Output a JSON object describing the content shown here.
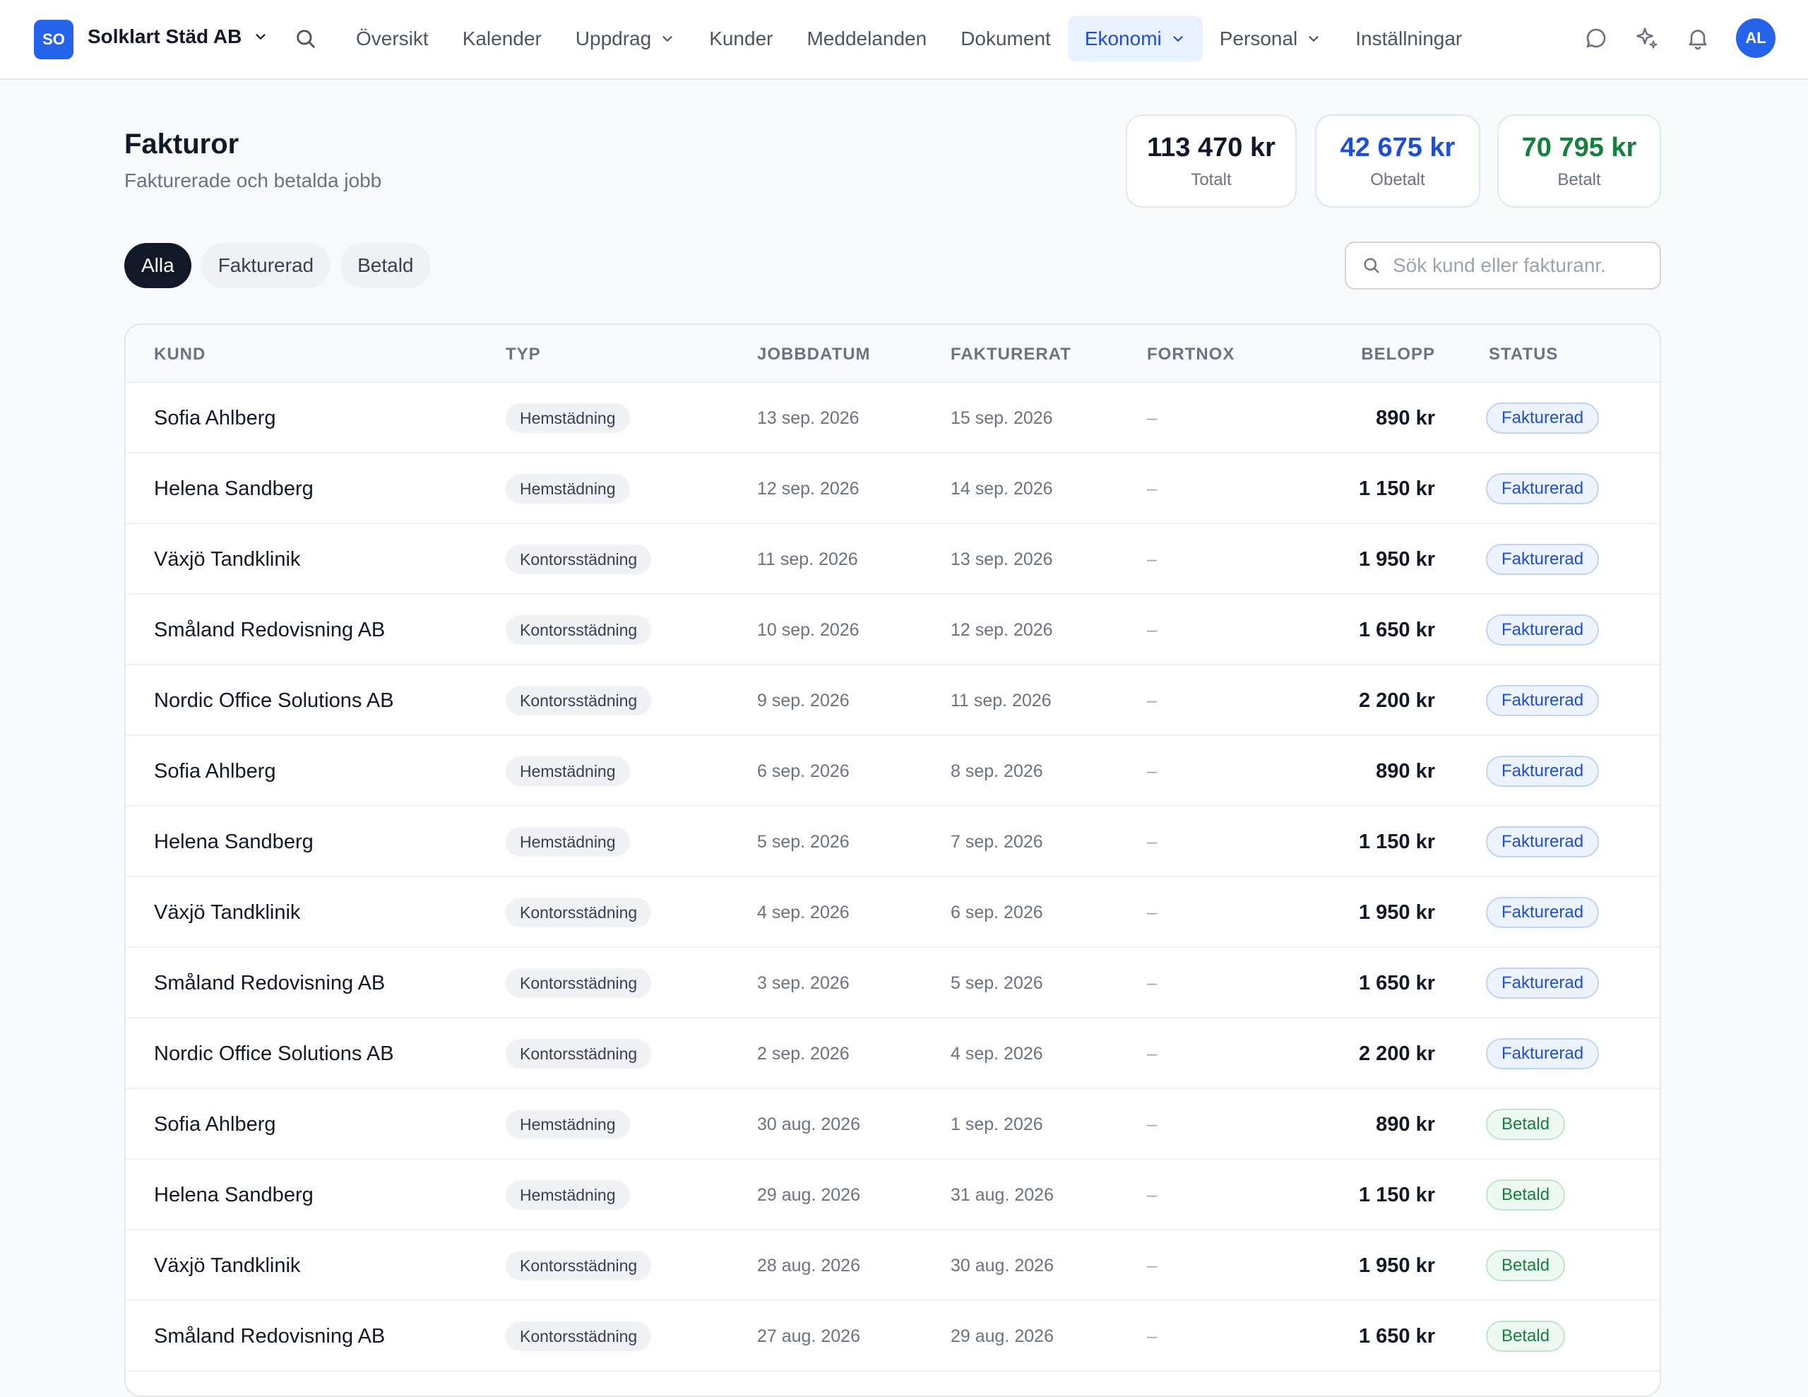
{
  "nav": {
    "logo": "SO",
    "company": "Solklart Städ AB",
    "items": [
      {
        "label": "Översikt",
        "dropdown": false,
        "active": false
      },
      {
        "label": "Kalender",
        "dropdown": false,
        "active": false
      },
      {
        "label": "Uppdrag",
        "dropdown": true,
        "active": false
      },
      {
        "label": "Kunder",
        "dropdown": false,
        "active": false
      },
      {
        "label": "Meddelanden",
        "dropdown": false,
        "active": false
      },
      {
        "label": "Dokument",
        "dropdown": false,
        "active": false
      },
      {
        "label": "Ekonomi",
        "dropdown": true,
        "active": true
      },
      {
        "label": "Personal",
        "dropdown": true,
        "active": false
      },
      {
        "label": "Inställningar",
        "dropdown": false,
        "active": false
      }
    ],
    "icons": [
      "chat-icon",
      "sparkle-icon",
      "bell-icon"
    ],
    "avatar": "AL"
  },
  "header": {
    "title": "Fakturor",
    "subtitle": "Fakturerade och betalda jobb"
  },
  "stats": {
    "total": {
      "value": "113 470 kr",
      "label": "Totalt"
    },
    "unpaid": {
      "value": "42 675 kr",
      "label": "Obetalt"
    },
    "paid": {
      "value": "70 795 kr",
      "label": "Betalt"
    }
  },
  "filters": [
    {
      "label": "Alla",
      "active": true
    },
    {
      "label": "Fakturerad",
      "active": false
    },
    {
      "label": "Betald",
      "active": false
    }
  ],
  "search": {
    "placeholder": "Sök kund eller fakturanr.",
    "value": ""
  },
  "table": {
    "columns": {
      "kund": "KUND",
      "typ": "TYP",
      "jobbdatum": "JOBBDATUM",
      "fakturerat": "FAKTURERAT",
      "fortnox": "FORTNOX",
      "belopp": "BELOPP",
      "status": "STATUS"
    },
    "rows": [
      {
        "kund": "Sofia Ahlberg",
        "typ": "Hemstädning",
        "jobbdatum": "13 sep. 2026",
        "fakturerat": "15 sep. 2026",
        "fortnox": "–",
        "belopp": "890 kr",
        "status": "Fakturerad"
      },
      {
        "kund": "Helena Sandberg",
        "typ": "Hemstädning",
        "jobbdatum": "12 sep. 2026",
        "fakturerat": "14 sep. 2026",
        "fortnox": "–",
        "belopp": "1 150 kr",
        "status": "Fakturerad"
      },
      {
        "kund": "Växjö Tandklinik",
        "typ": "Kontorsstädning",
        "jobbdatum": "11 sep. 2026",
        "fakturerat": "13 sep. 2026",
        "fortnox": "–",
        "belopp": "1 950 kr",
        "status": "Fakturerad"
      },
      {
        "kund": "Småland Redovisning AB",
        "typ": "Kontorsstädning",
        "jobbdatum": "10 sep. 2026",
        "fakturerat": "12 sep. 2026",
        "fortnox": "–",
        "belopp": "1 650 kr",
        "status": "Fakturerad"
      },
      {
        "kund": "Nordic Office Solutions AB",
        "typ": "Kontorsstädning",
        "jobbdatum": "9 sep. 2026",
        "fakturerat": "11 sep. 2026",
        "fortnox": "–",
        "belopp": "2 200 kr",
        "status": "Fakturerad"
      },
      {
        "kund": "Sofia Ahlberg",
        "typ": "Hemstädning",
        "jobbdatum": "6 sep. 2026",
        "fakturerat": "8 sep. 2026",
        "fortnox": "–",
        "belopp": "890 kr",
        "status": "Fakturerad"
      },
      {
        "kund": "Helena Sandberg",
        "typ": "Hemstädning",
        "jobbdatum": "5 sep. 2026",
        "fakturerat": "7 sep. 2026",
        "fortnox": "–",
        "belopp": "1 150 kr",
        "status": "Fakturerad"
      },
      {
        "kund": "Växjö Tandklinik",
        "typ": "Kontorsstädning",
        "jobbdatum": "4 sep. 2026",
        "fakturerat": "6 sep. 2026",
        "fortnox": "–",
        "belopp": "1 950 kr",
        "status": "Fakturerad"
      },
      {
        "kund": "Småland Redovisning AB",
        "typ": "Kontorsstädning",
        "jobbdatum": "3 sep. 2026",
        "fakturerat": "5 sep. 2026",
        "fortnox": "–",
        "belopp": "1 650 kr",
        "status": "Fakturerad"
      },
      {
        "kund": "Nordic Office Solutions AB",
        "typ": "Kontorsstädning",
        "jobbdatum": "2 sep. 2026",
        "fakturerat": "4 sep. 2026",
        "fortnox": "–",
        "belopp": "2 200 kr",
        "status": "Fakturerad"
      },
      {
        "kund": "Sofia Ahlberg",
        "typ": "Hemstädning",
        "jobbdatum": "30 aug. 2026",
        "fakturerat": "1 sep. 2026",
        "fortnox": "–",
        "belopp": "890 kr",
        "status": "Betald"
      },
      {
        "kund": "Helena Sandberg",
        "typ": "Hemstädning",
        "jobbdatum": "29 aug. 2026",
        "fakturerat": "31 aug. 2026",
        "fortnox": "–",
        "belopp": "1 150 kr",
        "status": "Betald"
      },
      {
        "kund": "Växjö Tandklinik",
        "typ": "Kontorsstädning",
        "jobbdatum": "28 aug. 2026",
        "fakturerat": "30 aug. 2026",
        "fortnox": "–",
        "belopp": "1 950 kr",
        "status": "Betald"
      },
      {
        "kund": "Småland Redovisning AB",
        "typ": "Kontorsstädning",
        "jobbdatum": "27 aug. 2026",
        "fakturerat": "29 aug. 2026",
        "fortnox": "–",
        "belopp": "1 650 kr",
        "status": "Betald"
      }
    ]
  },
  "colors": {
    "accent": "#2563eb",
    "unpaid": "#1d4ed8",
    "paid": "#15803d",
    "active_pill": "#111827"
  }
}
